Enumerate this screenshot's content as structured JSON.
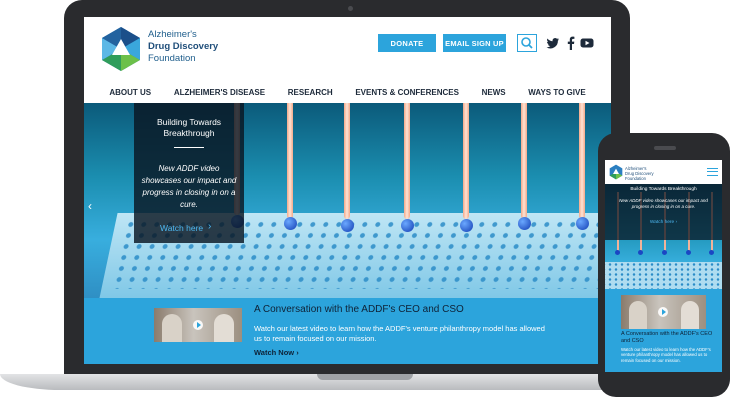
{
  "org": {
    "name_line1": "Alzheimer's",
    "name_line2": "Drug Discovery",
    "name_line3": "Foundation"
  },
  "header": {
    "donate_label": "DONATE",
    "email_label": "EMAIL SIGN UP",
    "icons": [
      "search-icon",
      "twitter-icon",
      "facebook-icon",
      "youtube-icon"
    ]
  },
  "nav": [
    "ABOUT US",
    "ALZHEIMER'S DISEASE",
    "RESEARCH",
    "EVENTS & CONFERENCES",
    "NEWS",
    "WAYS TO GIVE"
  ],
  "hero": {
    "title_line1": "Building Towards",
    "title_line2": "Breakthrough",
    "body": "New ADDF video showcases our impact and progress in closing in on a cure.",
    "link": "Watch here",
    "chevron": "›",
    "prev_arrow": "‹"
  },
  "video": {
    "title": "A Conversation with the ADDF's CEO and CSO",
    "body": "Watch our latest video to learn how the ADDF's venture philanthropy model has allowed us to remain focused on our mission.",
    "link": "Watch Now",
    "link_chevron": "›"
  },
  "mobile": {
    "hero_title": "Building Towards Breakthrough",
    "hero_body": "New ADDF video showcases our impact and progress in closing in on a cure.",
    "hero_link": "Watch here",
    "video_title": "A Conversation with the ADDF's CEO and CSO",
    "video_body": "Watch our latest video to learn how the ADDF's venture philanthropy model has allowed us to remain focused on our mission."
  },
  "colors": {
    "brand_blue": "#2ca4dc",
    "navy": "#1f4e7a",
    "device_frame": "#2a2b2e"
  }
}
